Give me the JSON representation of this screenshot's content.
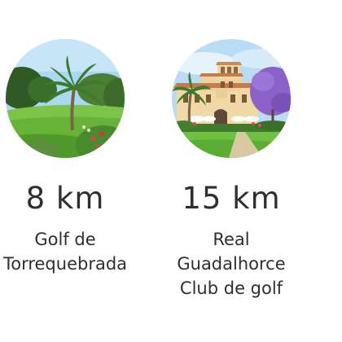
{
  "locations": [
    {
      "distance": "8 km",
      "name_lines": [
        "Golf de",
        "Torrequebrada"
      ],
      "photo_icon": "golf-course-palm-photo"
    },
    {
      "distance": "15 km",
      "name_lines": [
        "Real",
        "Guadalhorce",
        "Club de golf"
      ],
      "photo_icon": "golf-clubhouse-photo"
    }
  ],
  "colors": {
    "text": "#2f2f2f",
    "grass": "#6fbf3a",
    "sky": "#9fd4f2",
    "building": "#f2d9a8",
    "jacaranda": "#8a5fc9"
  }
}
